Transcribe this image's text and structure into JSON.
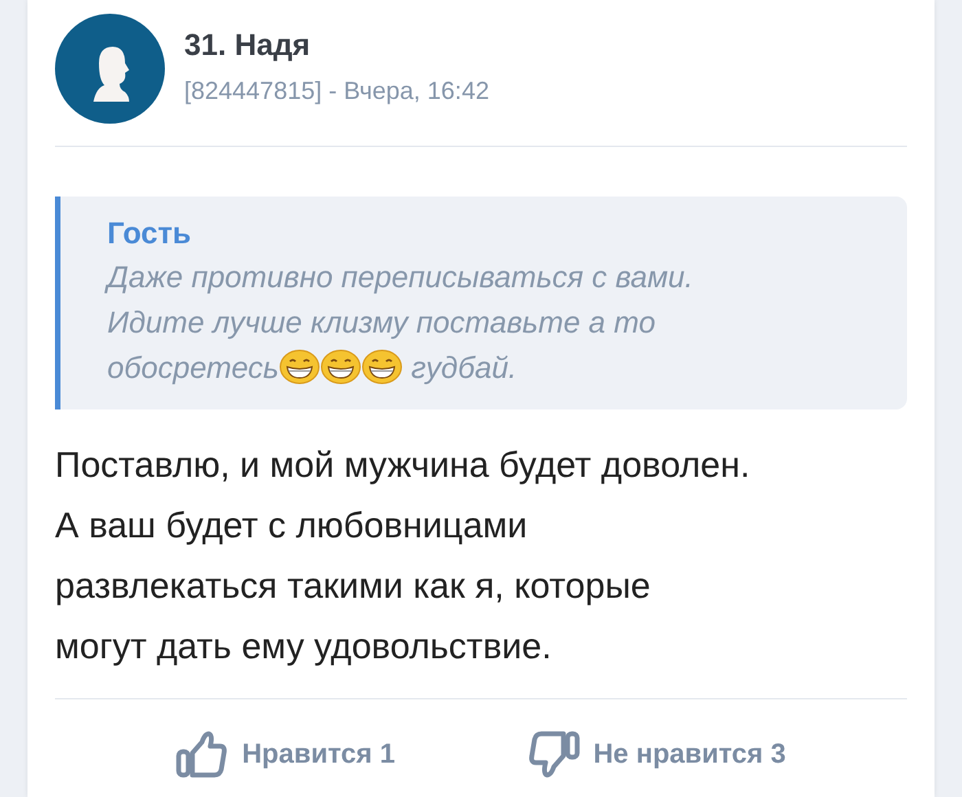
{
  "post": {
    "author": "31. Надя",
    "meta": "[824447815] - Вчера, 16:42"
  },
  "quote": {
    "author": "Гость",
    "lines": [
      "Даже противно переписываться с вами.",
      "Идите лучше клизму поставьте а то"
    ],
    "text_before": "обосретесь",
    "emojis": [
      {
        "kind": "grin"
      },
      {
        "kind": "grin"
      },
      {
        "kind": "grin"
      }
    ],
    "text_after": "гудбай."
  },
  "message_lines": [
    "Поставлю, и мой мужчина будет доволен.",
    "А ваш будет с любовницами",
    "развлекаться такими как я, которые",
    "могут дать ему удовольствие."
  ],
  "actions": [
    {
      "kind": "like",
      "label": "Нравится 1"
    },
    {
      "kind": "dislike",
      "label": "Не нравится 3"
    }
  ]
}
